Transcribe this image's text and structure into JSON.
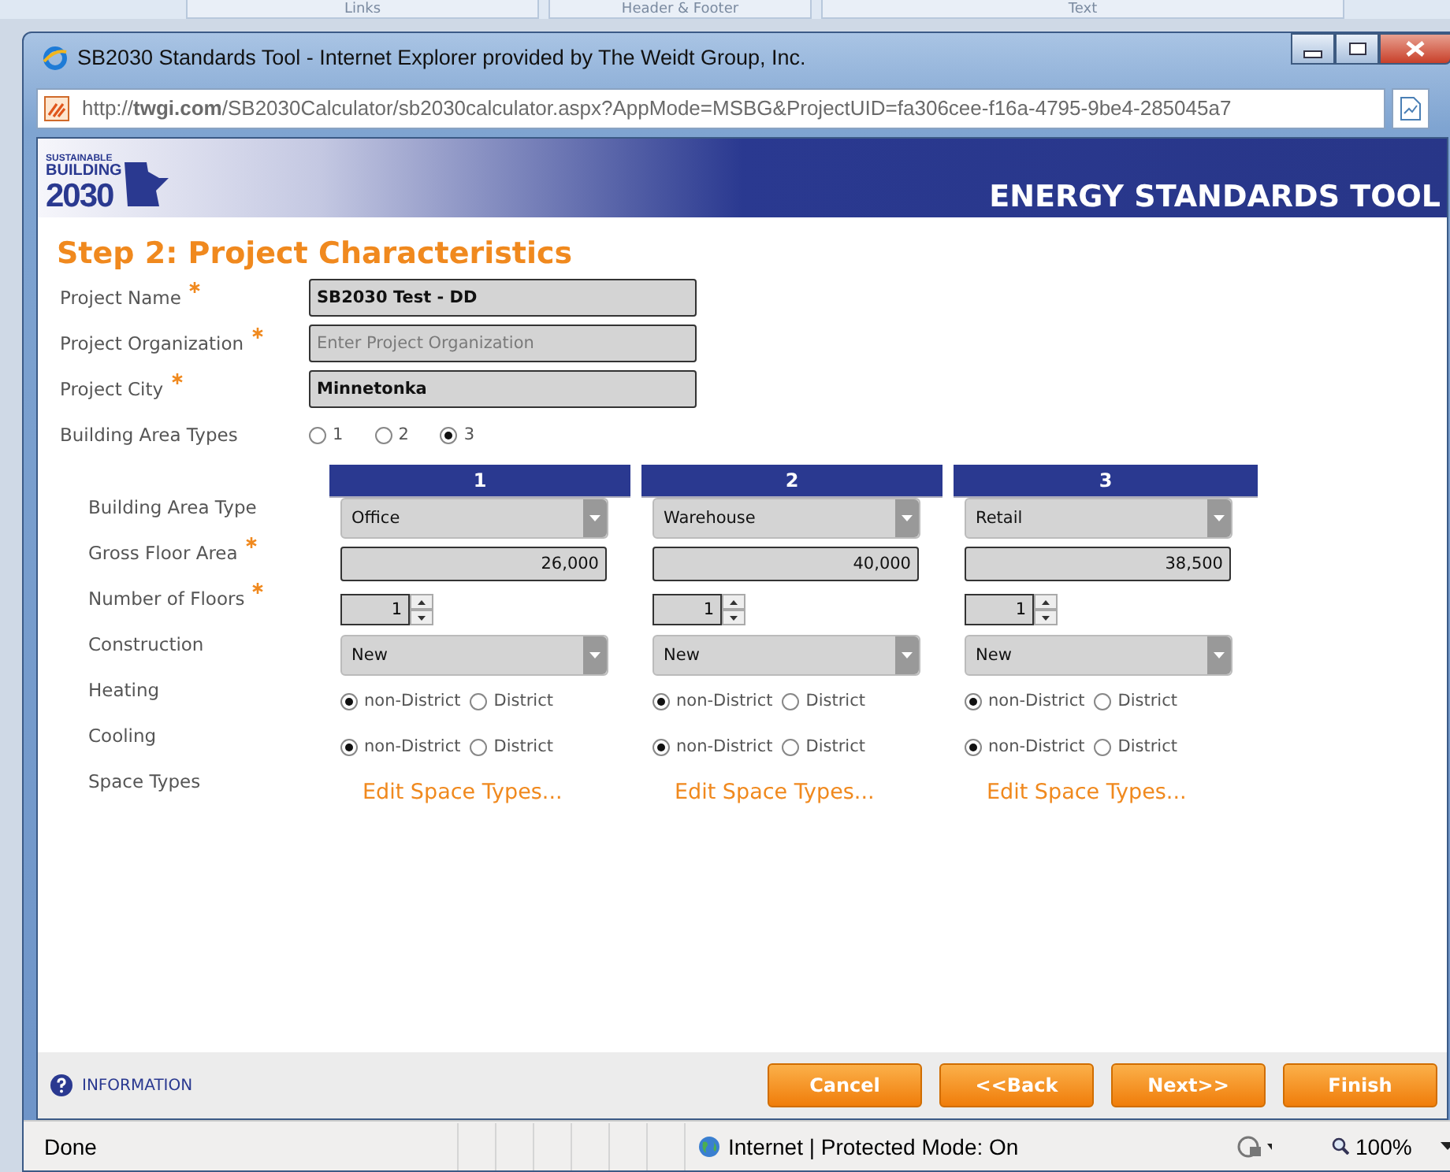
{
  "background_ribbon": {
    "tabs": [
      "Links",
      "Header & Footer",
      "Text"
    ]
  },
  "window": {
    "title": "SB2030 Standards Tool - Internet Explorer provided by The Weidt Group, Inc.",
    "url": "http://**twgi.com**/SB2030Calculator/sb2030calculator.aspx?AppMode=MSBG&ProjectUID=fa306cee-f16a-4795-9be4-285045a7"
  },
  "banner": {
    "logo_lines": [
      "SUSTAINABLE",
      "BUILDING",
      "2030"
    ],
    "heading": "ENERGY STANDARDS TOOL"
  },
  "form": {
    "title": "Step 2: Project Characteristics",
    "fields": [
      {
        "label": "Project Name",
        "required": true,
        "value": "SB2030 Test - DD"
      },
      {
        "label": "Project Organization",
        "required": true,
        "placeholder": "Enter Project Organization"
      },
      {
        "label": "Project City",
        "required": true,
        "value": "Minnetonka"
      }
    ],
    "area_types": {
      "label": "Building Area Types",
      "options": [
        {
          "label": "1",
          "selected": false
        },
        {
          "label": "2",
          "selected": false
        },
        {
          "label": "3",
          "selected": true
        }
      ]
    },
    "row_labels": [
      {
        "label": "Building Area Type",
        "required": false
      },
      {
        "label": "Gross Floor Area",
        "required": true
      },
      {
        "label": "Number of Floors",
        "required": true
      },
      {
        "label": "Construction",
        "required": false
      },
      {
        "label": "Heating",
        "required": false
      },
      {
        "label": "Cooling",
        "required": false
      },
      {
        "label": "Space Types",
        "required": false
      }
    ],
    "columns": [
      {
        "header": "1",
        "building_area_type": "Office",
        "gross_floor_area": "26,000",
        "floors": "1",
        "construction": "New",
        "heating": [
          {
            "label": "non-District",
            "selected": true
          },
          {
            "label": "District",
            "selected": false
          }
        ],
        "cooling": [
          {
            "label": "non-District",
            "selected": true
          },
          {
            "label": "District",
            "selected": false
          }
        ],
        "space_types_link": "Edit Space Types..."
      },
      {
        "header": "2",
        "building_area_type": "Warehouse",
        "gross_floor_area": "40,000",
        "floors": "1",
        "construction": "New",
        "heating": [
          {
            "label": "non-District",
            "selected": true
          },
          {
            "label": "District",
            "selected": false
          }
        ],
        "cooling": [
          {
            "label": "non-District",
            "selected": true
          },
          {
            "label": "District",
            "selected": false
          }
        ],
        "space_types_link": "Edit Space Types..."
      },
      {
        "header": "3",
        "building_area_type": "Retail",
        "gross_floor_area": "38,500",
        "floors": "1",
        "construction": "New",
        "heating": [
          {
            "label": "non-District",
            "selected": true
          },
          {
            "label": "District",
            "selected": false
          }
        ],
        "cooling": [
          {
            "label": "non-District",
            "selected": true
          },
          {
            "label": "District",
            "selected": false
          }
        ],
        "space_types_link": "Edit Space Types..."
      }
    ]
  },
  "footer": {
    "info": "INFORMATION",
    "buttons": [
      "Cancel",
      "<<Back",
      "Next>>",
      "Finish"
    ]
  },
  "status_bar": {
    "text": "Done",
    "zone": "Internet | Protected Mode: On",
    "zoom": "100%"
  }
}
